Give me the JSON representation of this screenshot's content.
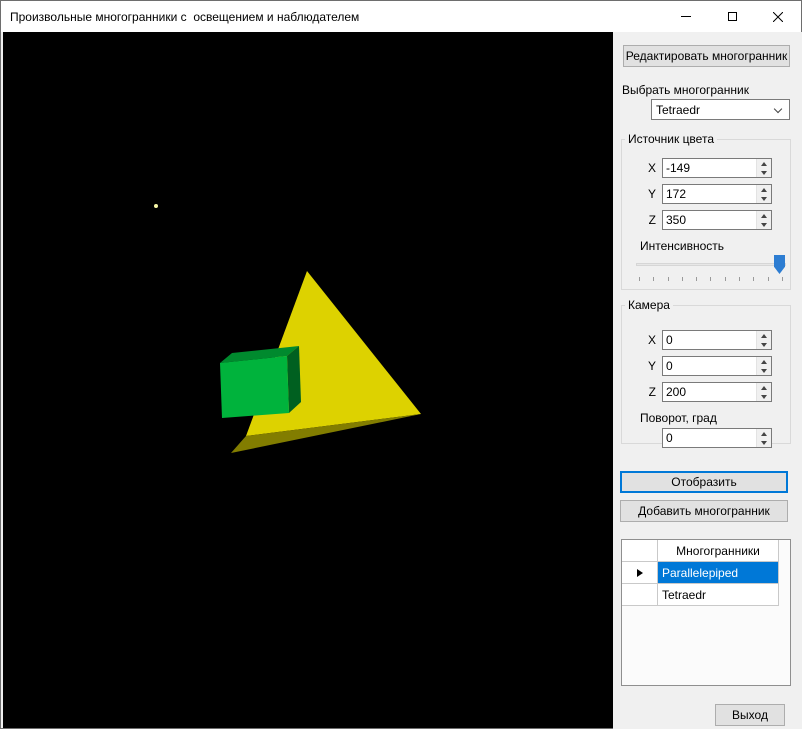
{
  "window": {
    "title": "Произвольные многогранники с  освещением и наблюдателем"
  },
  "accent_color": "#0078d7",
  "scene": {
    "background": "#000000",
    "light_dot": "#f6f6a6",
    "tetra_front": "#ddd200",
    "tetra_base": "#827d00",
    "cube_front": "#00b33c",
    "cube_top": "#008a2e",
    "cube_side": "#006020"
  },
  "panel": {
    "edit_button": "Редактировать многогранник",
    "select_label": "Выбрать многогранник",
    "combo_value": "Tetraedr",
    "light": {
      "title": "Источник цвета",
      "x_label": "X",
      "x_value": "-149",
      "y_label": "Y",
      "y_value": "172",
      "z_label": "Z",
      "z_value": "350",
      "intensity_label": "Интенсивность"
    },
    "camera": {
      "title": "Камера",
      "x_label": "X",
      "x_value": "0",
      "y_label": "Y",
      "y_value": "0",
      "z_label": "Z",
      "z_value": "200",
      "rotation_label": "Поворот, град",
      "rotation_value": "0"
    },
    "display_button": "Отобразить",
    "add_button": "Добавить многогранник",
    "grid": {
      "header": "Многогранники",
      "rows": [
        {
          "name": "Parallelepiped",
          "selected": true
        },
        {
          "name": "Tetraedr",
          "selected": false
        }
      ]
    },
    "exit_button": "Выход"
  }
}
